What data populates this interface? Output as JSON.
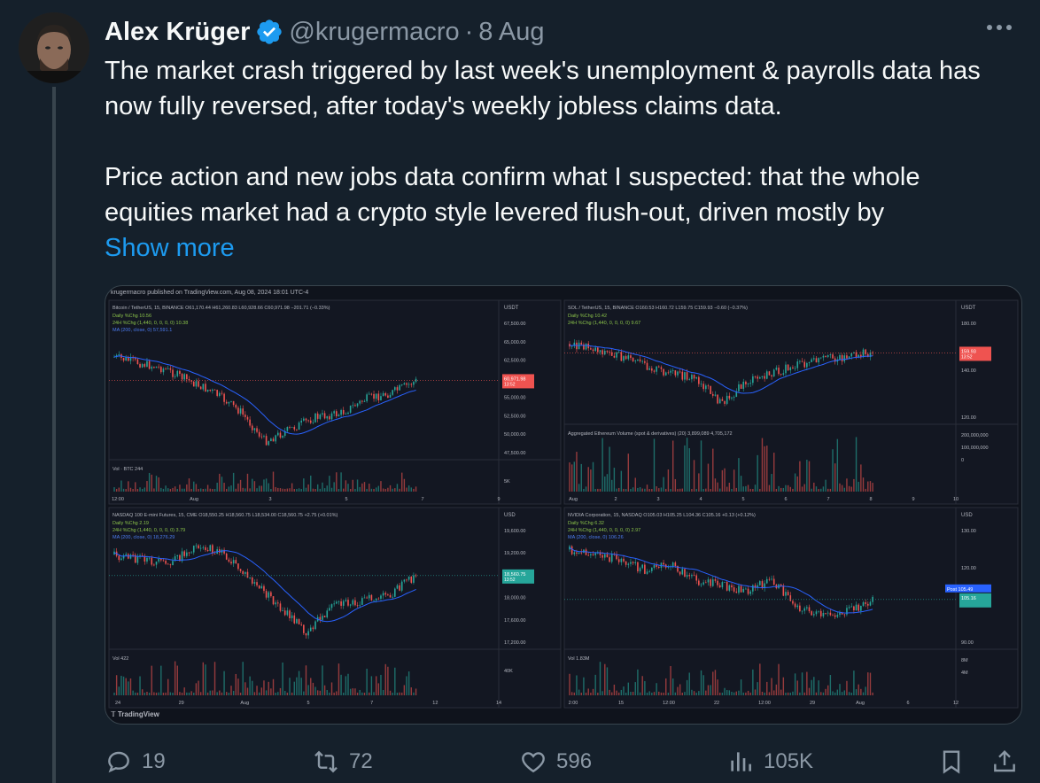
{
  "author": {
    "name": "Alex Krüger",
    "handle": "@krugermacro",
    "separator": "·",
    "date": "8 Aug"
  },
  "tweet": {
    "paragraph1": "The market crash triggered by last week's unemployment & payrolls data has now fully reversed, after today's weekly jobless claims data.",
    "paragraph2": "Price action and new jobs data confirm what I suspected: that the whole equities market had a crypto style levered flush-out, driven mostly by",
    "show_more": "Show more"
  },
  "media": {
    "header": "krugermacro published on TradingView.com, Aug 08, 2024 18:01 UTC-4",
    "footer": "TradingView",
    "panels": [
      {
        "title": "Bitcoin / TetherUS, 15, BINANCE",
        "ohlc": "O61,170.44 H61,260.83 L60,928.66 C60,971.98 −201.71 (−0.33%)",
        "lines": [
          "Daily %Chg 10.56",
          "24H %Chg (1,440, 0, 0, 0, 0) 10.38",
          "MA (200, close, 0) 57,591.1"
        ],
        "currency": "USDT",
        "y_ticks": [
          "67,500.00",
          "65,000.00",
          "62,500.00",
          "57,500.00",
          "55,000.00",
          "52,500.00",
          "50,000.00",
          "47,500.00"
        ],
        "last_price": "60,971.98",
        "last_time": "13:52",
        "volume_label": "Vol · BTC",
        "volume_value": "244",
        "volume_tick": "5K",
        "x_ticks": [
          "12:00",
          "Aug",
          "3",
          "5",
          "7",
          "9"
        ]
      },
      {
        "title": "SOL / TetherUS, 15, BINANCE",
        "ohlc": "O160.53 H160.72 L159.75 C159.93 −0.60 (−0.37%)",
        "lines": [
          "Daily %Chg 10.42",
          "24H %Chg (1,440, 0, 0, 0, 0) 9.67"
        ],
        "currency": "USDT",
        "y_ticks": [
          "180.00",
          "140.00",
          "120.00"
        ],
        "last_price": "159.93",
        "last_time": "13:52",
        "volume_label": "Aggregated Ethereum Volume (spot & derivatives) (20)",
        "volume_value": "3,899,089 4,705,172",
        "volume_ticks": [
          "200,000,000",
          "100,000,000",
          "0"
        ],
        "x_ticks": [
          "Aug",
          "2",
          "3",
          "4",
          "5",
          "6",
          "7",
          "8",
          "9",
          "10"
        ]
      },
      {
        "title": "NASDAQ 100 E-mini Futures, 15, CME",
        "ohlc": "O18,550.25 H18,560.75 L18,534.00 C18,560.75 +2.75 (+0.01%)",
        "lines": [
          "Daily %Chg 2.19",
          "24H %Chg (1,440, 0, 0, 0, 0) 3.79",
          "MA (200, close, 0) 18,276.29"
        ],
        "currency": "USD",
        "y_ticks": [
          "19,600.00",
          "19,200.00",
          "18,800.00",
          "18,000.00",
          "17,600.00",
          "17,200.00"
        ],
        "last_price": "18,560.75",
        "last_time": "13:52",
        "volume_label": "Vol",
        "volume_value": "422",
        "volume_tick": "40K",
        "x_ticks": [
          "24",
          "29",
          "Aug",
          "5",
          "7",
          "12",
          "14"
        ]
      },
      {
        "title": "NVIDIA Corporation, 15, NASDAQ",
        "ohlc": "O105.03 H105.25 L104.36 C105.16 +0.13 (+0.12%)",
        "lines": [
          "Daily %Chg 6.32",
          "24H %Chg (1,440, 0, 0, 0, 0) 2.97",
          "MA (200, close, 0) 106.26"
        ],
        "currency": "USD",
        "y_ticks": [
          "130.00",
          "120.00",
          "100.00",
          "90.00"
        ],
        "post_label": "Post",
        "post_price": "105.49",
        "last_price": "105.16",
        "volume_label": "Vol",
        "volume_value": "1.83M",
        "volume_ticks": [
          "8M",
          "4M"
        ],
        "x_ticks": [
          "2:00",
          "15",
          "12:00",
          "22",
          "12:00",
          "29",
          "Aug",
          "6",
          "12"
        ]
      }
    ]
  },
  "actions": {
    "replies": "19",
    "reposts": "72",
    "likes": "596",
    "views": "105K"
  },
  "colors": {
    "background": "#15202b",
    "accent": "#1d9bf0",
    "muted": "#8b98a5",
    "candle_up": "#26a69a",
    "candle_down": "#ef5350",
    "ma_line": "#2962ff"
  }
}
